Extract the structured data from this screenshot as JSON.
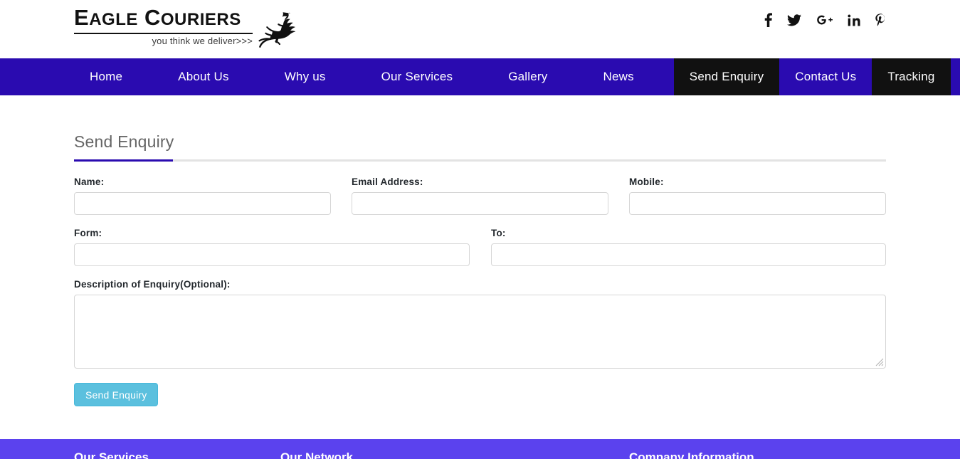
{
  "brand": {
    "name_part1": "E",
    "name_part1_rest": "AGLE",
    "name_part2": "C",
    "name_part2_rest": "OURIERS",
    "full_name": "EAGLE COURIERS",
    "tagline": "you think we deliver>>>",
    "bird_icon": "eagle-icon"
  },
  "social": {
    "items": [
      {
        "name": "facebook-icon",
        "glyph": "f",
        "label": "Facebook"
      },
      {
        "name": "twitter-icon",
        "glyph": "",
        "label": "Twitter"
      },
      {
        "name": "google-plus-icon",
        "glyph": "G+",
        "label": "Google Plus"
      },
      {
        "name": "linkedin-icon",
        "glyph": "in",
        "label": "LinkedIn"
      },
      {
        "name": "pinterest-icon",
        "glyph": "P",
        "label": "Pinterest"
      }
    ]
  },
  "nav": {
    "items": [
      {
        "label": "Home",
        "active": false
      },
      {
        "label": "About Us",
        "active": false
      },
      {
        "label": "Why us",
        "active": false
      },
      {
        "label": "Our Services",
        "active": false
      },
      {
        "label": "Gallery",
        "active": false
      },
      {
        "label": "News",
        "active": false
      },
      {
        "label": "Send Enquiry",
        "active": true
      },
      {
        "label": "Contact Us",
        "active": false
      },
      {
        "label": "Tracking",
        "active": true
      }
    ],
    "background_color": "#2a0bb0",
    "active_color": "#111111"
  },
  "page": {
    "title": "Send Enquiry",
    "accent_color": "#2a0bb0"
  },
  "form": {
    "name": {
      "label": "Name:",
      "value": "",
      "placeholder": ""
    },
    "email": {
      "label": "Email Address:",
      "value": "",
      "placeholder": ""
    },
    "mobile": {
      "label": "Mobile:",
      "value": "",
      "placeholder": ""
    },
    "from": {
      "label": "Form:",
      "value": "",
      "placeholder": ""
    },
    "to": {
      "label": "To:",
      "value": "",
      "placeholder": ""
    },
    "description": {
      "label": "Description of Enquiry(Optional):",
      "value": "",
      "placeholder": ""
    },
    "submit_label": "Send Enquiry",
    "submit_color": "#5bc0de"
  },
  "footer": {
    "background_color": "#5b42ee",
    "headings": [
      {
        "label": "Our Services"
      },
      {
        "label": "Our Network"
      },
      {
        "label": "Company Information"
      }
    ]
  }
}
